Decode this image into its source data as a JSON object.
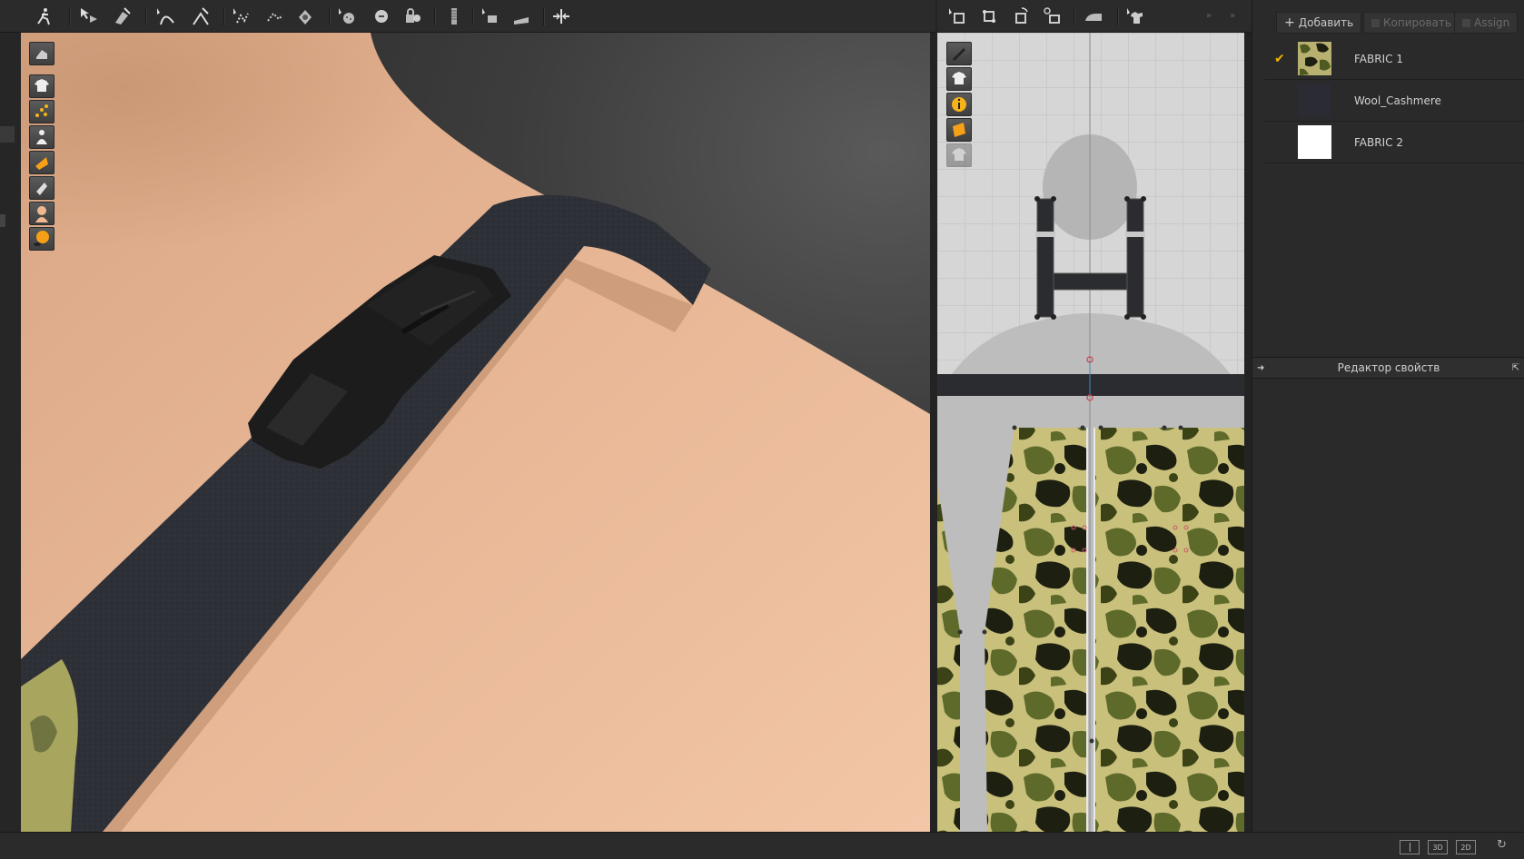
{
  "toolbar": {
    "icons": [
      "avatar-pose-icon",
      "select-move-icon",
      "transform-pattern-icon",
      "edit-curve-icon",
      "edit-point-icon",
      "segment-sewing-icon",
      "free-sewing-icon",
      "tack-icon",
      "button-icon",
      "buttonhole-icon",
      "lock-icon",
      "zipper-icon",
      "fold-tool-icon",
      "ruler-icon",
      "arrange-icon",
      "edit-pattern-2d-icon",
      "transform-2d-icon",
      "rotate-2d-icon",
      "trace-2d-icon",
      "iron-icon",
      "garment-icon"
    ]
  },
  "viewport_tools": [
    "reset-view-icon",
    "show-garment-icon",
    "show-points-icon",
    "show-avatar-icon",
    "texture-mode-icon",
    "render-mode-icon",
    "skin-icon",
    "avatar-visibility-icon"
  ],
  "pattern_tools": [
    "pencil-visibility-icon",
    "show-shirt-icon",
    "info-icon",
    "fabric-texture-icon",
    "lock-pattern-icon"
  ],
  "panel": {
    "add_label": "Добавить",
    "copy_label": "Копировать",
    "assign_label": "Assign",
    "fabrics": [
      {
        "name": "FABRIC 1",
        "selected": true,
        "swatch": "camo"
      },
      {
        "name": "Wool_Cashmere",
        "selected": false,
        "swatch": "#2a2b33"
      },
      {
        "name": "FABRIC 2",
        "selected": false,
        "swatch": "#ffffff"
      }
    ],
    "properties_title": "Редактор свойств"
  },
  "statusbar": {
    "view_buttons": [
      "",
      "3D",
      "2D"
    ]
  },
  "colors": {
    "checkmark": "#f0b400",
    "skin": "#e8b591",
    "strap": "#2f3138",
    "camo_light": "#c8c07a",
    "camo_mid": "#6b7338",
    "camo_dark": "#1e2212"
  }
}
